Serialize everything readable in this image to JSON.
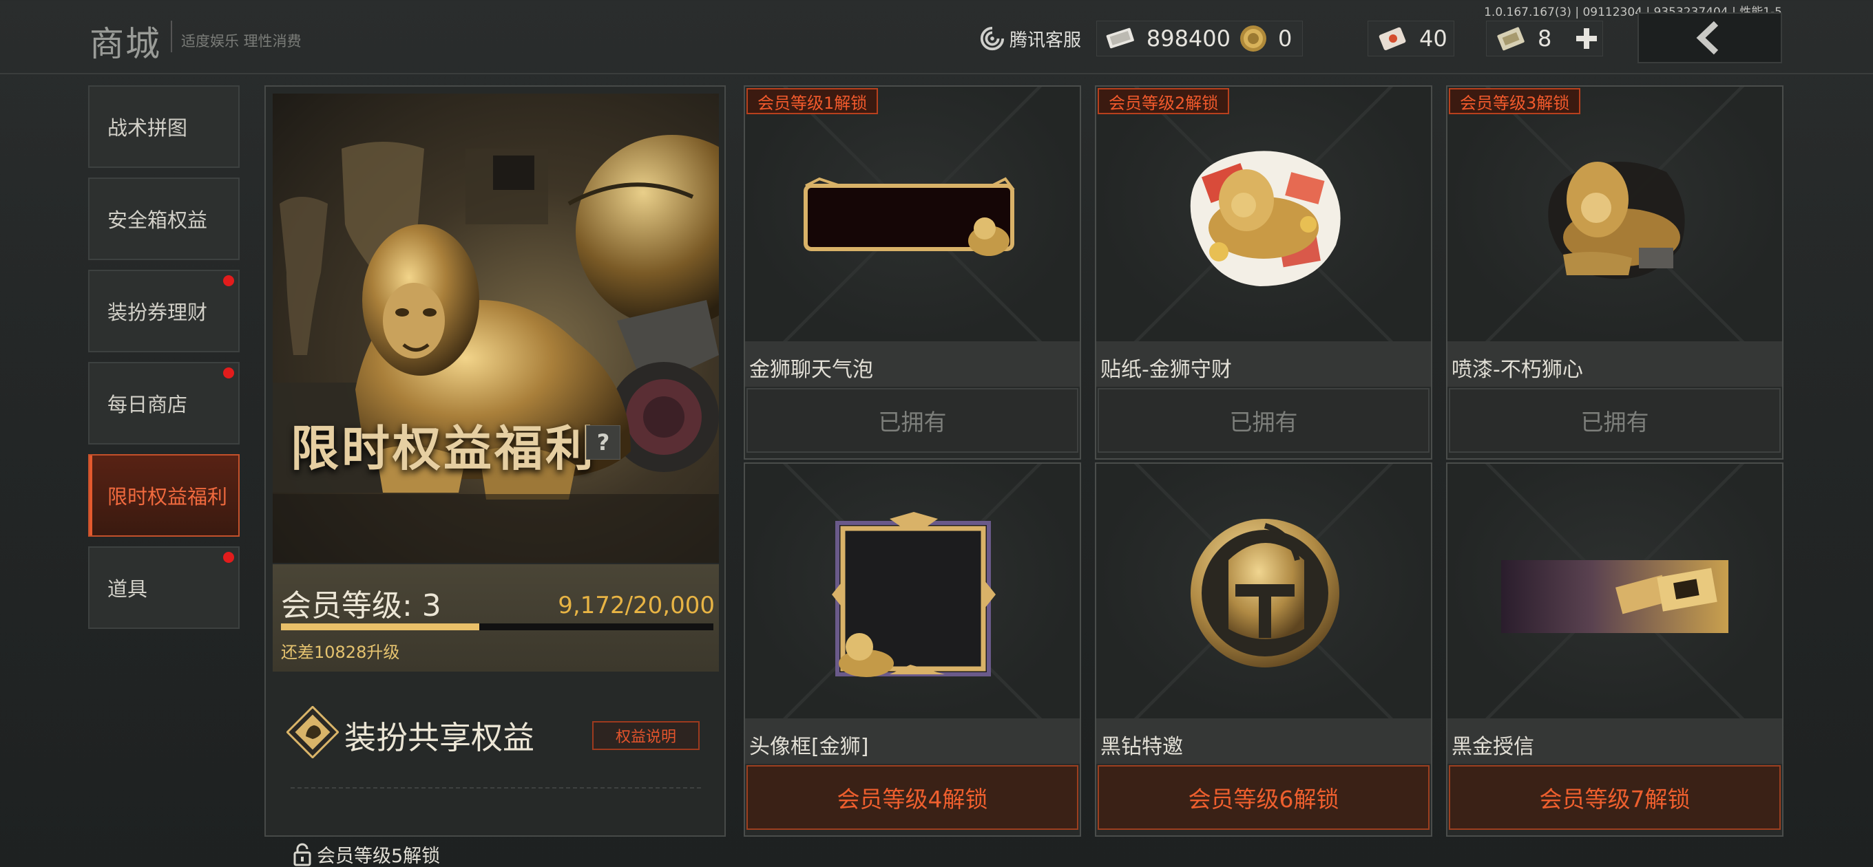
{
  "header": {
    "title": "商城",
    "subtitle": "适度娱乐 理性消费",
    "version": "1.0.167.167(3) | 09112304 | 9353237404 | 性能1-5",
    "service_label": "腾讯客服",
    "currencies": [
      {
        "icon": "cash-icon",
        "value": "898400"
      },
      {
        "icon": "gold-coin-icon",
        "value": "0"
      },
      {
        "icon": "voucher-icon",
        "value": "40"
      },
      {
        "icon": "ticket-icon",
        "value": "8"
      }
    ]
  },
  "sidebar": {
    "items": [
      {
        "label": "战术拼图",
        "dot": false,
        "active": false
      },
      {
        "label": "安全箱权益",
        "dot": false,
        "active": false
      },
      {
        "label": "装扮券理财",
        "dot": true,
        "active": false
      },
      {
        "label": "每日商店",
        "dot": true,
        "active": false
      },
      {
        "label": "限时权益福利",
        "dot": false,
        "active": true
      },
      {
        "label": "道具",
        "dot": true,
        "active": false
      }
    ]
  },
  "promo": {
    "title": "限时权益福利",
    "help": "?",
    "level_label": "会员等级: 3",
    "points": "9,172/20,000",
    "progress": 0.4586,
    "need_text": "还差10828升级",
    "share_title": "装扮共享权益",
    "share_button": "权益说明",
    "lock_text": "会员等级5解锁"
  },
  "cards": [
    {
      "tag": "会员等级1解锁",
      "name": "金狮聊天气泡",
      "button": "已拥有",
      "state": "owned",
      "icon": "chat-bubble-icon"
    },
    {
      "tag": "会员等级2解锁",
      "name": "贴纸-金狮守财",
      "button": "已拥有",
      "state": "owned",
      "icon": "lion-sticker-icon"
    },
    {
      "tag": "会员等级3解锁",
      "name": "喷漆-不朽狮心",
      "button": "已拥有",
      "state": "owned",
      "icon": "lion-spray-icon"
    },
    {
      "tag": "",
      "name": "头像框[金狮]",
      "button": "会员等级4解锁",
      "state": "locked",
      "icon": "avatar-frame-icon"
    },
    {
      "tag": "",
      "name": "黑钻特邀",
      "button": "会员等级6解锁",
      "state": "locked",
      "icon": "helmet-emblem-icon"
    },
    {
      "tag": "",
      "name": "黑金授信",
      "button": "会员等级7解锁",
      "state": "locked",
      "icon": "black-gold-banner-icon"
    }
  ],
  "colors": {
    "accent": "#ee5f2e",
    "gold": "#e9c069",
    "background": "#242727"
  }
}
